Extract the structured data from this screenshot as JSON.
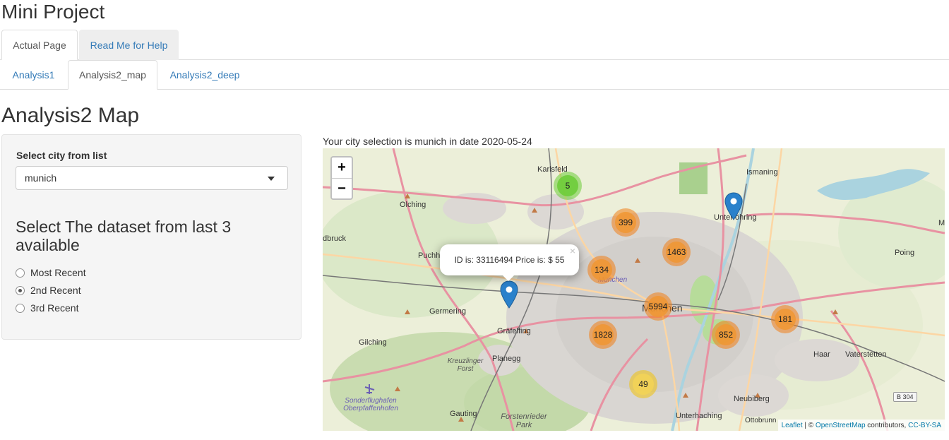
{
  "app": {
    "title": "Mini Project"
  },
  "tabs_top": [
    {
      "label": "Actual Page",
      "active": true
    },
    {
      "label": "Read Me for Help",
      "active": false
    }
  ],
  "tabs_sub": [
    {
      "label": "Analysis1",
      "active": false
    },
    {
      "label": "Analysis2_map",
      "active": true
    },
    {
      "label": "Analysis2_deep",
      "active": false
    }
  ],
  "section": {
    "title": "Analysis2 Map"
  },
  "sidebar": {
    "city_label": "Select city from list",
    "city_value": "munich",
    "dataset_heading": "Select The dataset from last 3 available",
    "radios": [
      {
        "label": "Most Recent",
        "checked": false
      },
      {
        "label": "2nd Recent",
        "checked": true
      },
      {
        "label": "3rd Recent",
        "checked": false
      }
    ]
  },
  "main": {
    "selection_text": "Your city selection is munich in date 2020-05-24"
  },
  "map": {
    "zoom_in": "+",
    "zoom_out": "−",
    "clusters": [
      {
        "count": "5",
        "color": "green"
      },
      {
        "count": "399",
        "color": "orange"
      },
      {
        "count": "1463",
        "color": "orange"
      },
      {
        "count": "134",
        "color": "orange"
      },
      {
        "count": "5994",
        "color": "orange"
      },
      {
        "count": "181",
        "color": "orange"
      },
      {
        "count": "1828",
        "color": "orange"
      },
      {
        "count": "852",
        "color": "orange"
      },
      {
        "count": "49",
        "color": "yellow"
      }
    ],
    "popup_text": "ID is: 33116494 Price is: $ 55",
    "popup_close": "×",
    "places": {
      "karlsfeld": "Karlsfeld",
      "ismaning": "Ismaning",
      "olching": "Olching",
      "unterfohring": "Unterföhring",
      "dbruck": "dbruck",
      "puchh": "Puchh",
      "poing": "Poing",
      "germering": "Germering",
      "munchen": "München",
      "grafelfing": "Gräfelfing",
      "gilching": "Gilching",
      "planegg": "Planegg",
      "haar": "Haar",
      "vaterstetten": "Vaterstetten",
      "neubiberg": "Neubiberg",
      "gauting": "Gauting",
      "unterhaching": "Unterhaching",
      "ottobrunn": "Ottobrunn",
      "kreuzlinger": "Kreuzlinger Forst",
      "forstenrieder": "Forstenrieder Park",
      "sonderflughafen": "Sonderflughafen Oberpfaffenhofen",
      "munchen_small": "München",
      "ma": "Ma"
    },
    "shield": "B 304",
    "attribution": {
      "leaflet": "Leaflet",
      "sep": " | © ",
      "osm": "OpenStreetMap",
      "contributors": " contributors, ",
      "license": "CC-BY-SA"
    }
  }
}
